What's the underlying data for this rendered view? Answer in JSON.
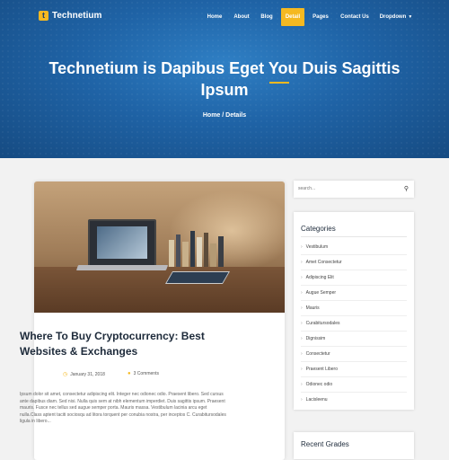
{
  "brand": {
    "logo_letter": "t",
    "name": "Technetium"
  },
  "nav": [
    {
      "label": "Home",
      "active": false
    },
    {
      "label": "About",
      "active": false
    },
    {
      "label": "Blog",
      "active": false
    },
    {
      "label": "Detail",
      "active": true
    },
    {
      "label": "Pages",
      "active": false
    },
    {
      "label": "Contact Us",
      "active": false
    },
    {
      "label": "Dropdown",
      "active": false,
      "icon": "chevron-down-icon"
    }
  ],
  "hero": {
    "title": "Technetium is Dapibus Eget You Duis Sagittis Ipsum",
    "breadcrumb": "Home / Details"
  },
  "post": {
    "title": "Where To Buy Cryptocurrency: Best Websites & Exchanges",
    "date": "January 31, 2018",
    "comments": "3 Comments",
    "excerpt": "Ipsum dolor sit amet, consectetur adipiscing elit. Integer nec odionec odio. Praesent libero. Sed cursus ante dapibus diam. Sed nisi. Nulla quis sem at nibh elementum imperdiet. Duis sagittis ipsum. Praesent mauris. Fusce nec tellus sed augue semper porta. Mauris massa. Vestibulum lacinia arcu eget nulla.Class aptent taciti sociosqu ad litora torquent per conubia nostra, per inceptos C. Curabitursodales ligula in libero..."
  },
  "search": {
    "placeholder": "search..."
  },
  "categories": {
    "title": "Categories",
    "items": [
      "Vestibulum",
      "Amet Consectetur",
      "Adipiscing Elit",
      "Augue Semper",
      "Mauris",
      "Curabitursodales",
      "Dignissim",
      "Consectetur",
      "Praesent Libero",
      "Odionec odio",
      "Lacisleenu"
    ]
  },
  "recent": {
    "title": "Recent Grades"
  },
  "colors": {
    "accent": "#f5b921",
    "hero_blue": "#1f63a6",
    "text_dark": "#1d2a3a"
  }
}
